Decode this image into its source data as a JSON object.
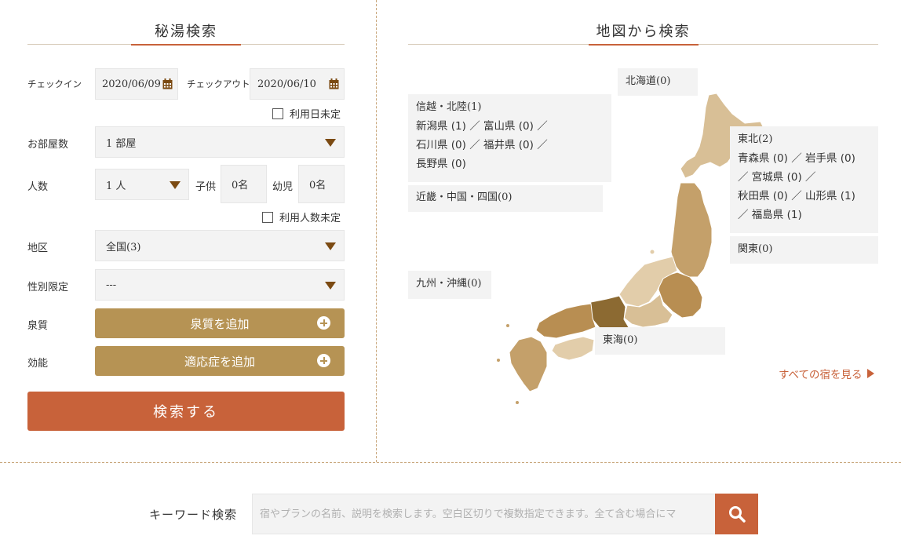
{
  "left": {
    "title": "秘湯検索",
    "checkin_label": "チェックイン",
    "checkin_value": "2020/06/09",
    "checkout_label": "チェックアウト",
    "checkout_value": "2020/06/10",
    "date_undecided": "利用日未定",
    "rooms_label": "お部屋数",
    "rooms_value": "1 部屋",
    "people_label": "人数",
    "people_value": "1 人",
    "child_label": "子供",
    "child_value": "0名",
    "infant_label": "幼児",
    "infant_value": "0名",
    "people_undecided": "利用人数未定",
    "area_label": "地区",
    "area_value": "全国(3)",
    "gender_label": "性別限定",
    "gender_value": "---",
    "quality_label": "泉質",
    "quality_button": "泉質を追加",
    "efficacy_label": "効能",
    "efficacy_button": "適応症を追加",
    "search_button": "検索する"
  },
  "right": {
    "title": "地図から検索",
    "regions": {
      "hokkaido": "北海道(0)",
      "shinetsu": "信越・北陸(1)",
      "shinetsu_line1": "新潟県 (1) ／ 富山県 (0) ／",
      "shinetsu_line2": "石川県 (0) ／ 福井県 (0) ／",
      "shinetsu_line3": "長野県 (0)",
      "kinki": "近畿・中国・四国(0)",
      "tohoku": "東北(2)",
      "tohoku_line1": "青森県 (0) ／ 岩手県 (0)",
      "tohoku_line2": "／ 宮城県 (0) ／",
      "tohoku_line3": "秋田県 (0) ／ 山形県 (1)",
      "tohoku_line4": "／ 福島県 (1)",
      "kanto": "関東(0)",
      "kyushu": "九州・沖縄(0)",
      "tokai": "東海(0)"
    },
    "see_all": "すべての宿を見る"
  },
  "keyword": {
    "label": "キーワード検索",
    "placeholder": "宿やプランの名前、説明を検索します。空白区切りで複数指定できます。全て含む場合にマ"
  },
  "colors": {
    "accent": "#c8623a",
    "gold": "#b69354",
    "field_bg": "#f3f3f3",
    "map_light": "#d8bf96",
    "map_mid": "#c4a06a",
    "map_dark": "#8c6a32"
  }
}
